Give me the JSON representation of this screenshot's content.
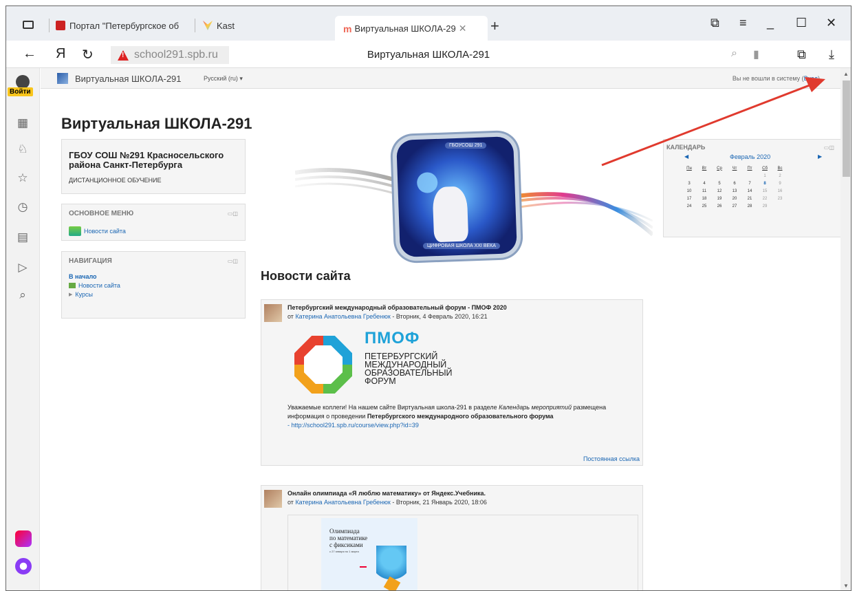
{
  "tabs": [
    {
      "label": "Портал \"Петербургское об"
    },
    {
      "label": "Kast"
    },
    {
      "label": "Виртуальная ШКОЛА-29"
    }
  ],
  "address": {
    "url": "school291.spb.ru",
    "title": "Виртуальная ШКОЛА-291"
  },
  "browser_sidebar": {
    "login_label": "Войти"
  },
  "site": {
    "name": "Виртуальная ШКОЛА-291",
    "language": "Русский (ru) ▾",
    "login_status": "Вы не вошли в систему (",
    "login_link": "Вход",
    "login_close": ")",
    "heading": "Виртуальная ШКОЛА-291"
  },
  "org_block": {
    "name": "ГБОУ СОШ №291 Красносельского района Санкт-Петербурга",
    "subtitle": "ДИСТАНЦИОННОЕ ОБУЧЕНИЕ"
  },
  "main_menu": {
    "title": "ОСНОВНОЕ МЕНЮ",
    "items": [
      "Новости сайта"
    ]
  },
  "navigation": {
    "title": "НАВИГАЦИЯ",
    "home": "В начало",
    "news": "Новости сайта",
    "courses": "Курсы"
  },
  "banner": {
    "caption_top": "ГБОУСОШ 291",
    "caption_bottom": "ЦИФРОВАЯ ШКОЛА XXI ВЕКА"
  },
  "news": {
    "heading": "Новости сайта",
    "posts": [
      {
        "title": "Петербургский международный образовательный форум - ПМОФ 2020",
        "by_prefix": "от ",
        "author": "Катерина Анатольевна Гребенюк",
        "date": " - Вторник, 4 Февраль 2020, 16:21",
        "logo_big": "ПМОФ",
        "logo_text": "ПЕТЕРБУРГСКИЙ\nМЕЖДУНАРОДНЫЙ\nОБРАЗОВАТЕЛЬНЫЙ\nФОРУМ",
        "text_1": "Уважаемые коллеги! На нашем сайте Виртуальная школа-291 в разделе ",
        "text_italic": "Календарь мероприятий",
        "text_2": " размещена информация о проведении ",
        "text_bold": "Петербургского международного образовательного форума",
        "link": "- http://school291.spb.ru/course/view.php?id=39",
        "permalink": "Постоянная ссылка"
      },
      {
        "title": "Онлайн олимпиада «Я люблю математику» от Яндекс.Учебника.",
        "by_prefix": "от ",
        "author": "Катерина Анатольевна Гребенюк",
        "date": " - Вторник, 21 Январь 2020, 18:06",
        "card_title": "Олимпиада\nпо математике\nс фиксиками",
        "card_sub": "с 27 января по 1 марта"
      }
    ]
  },
  "calendar": {
    "title": "КАЛЕНДАРЬ",
    "month": "Февраль 2020",
    "weekdays": [
      "Пн",
      "Вт",
      "Ср",
      "Чт",
      "Пт",
      "Сб",
      "Вс"
    ],
    "weeks": [
      [
        "",
        "",
        "",
        "",
        "",
        "1",
        "2"
      ],
      [
        "3",
        "4",
        "5",
        "6",
        "7",
        "8",
        "9"
      ],
      [
        "10",
        "11",
        "12",
        "13",
        "14",
        "15",
        "16"
      ],
      [
        "17",
        "18",
        "19",
        "20",
        "21",
        "22",
        "23"
      ],
      [
        "24",
        "25",
        "26",
        "27",
        "28",
        "29",
        ""
      ]
    ]
  },
  "colors": {
    "link": "#1a66b3",
    "arrow": "#e03a2e"
  }
}
